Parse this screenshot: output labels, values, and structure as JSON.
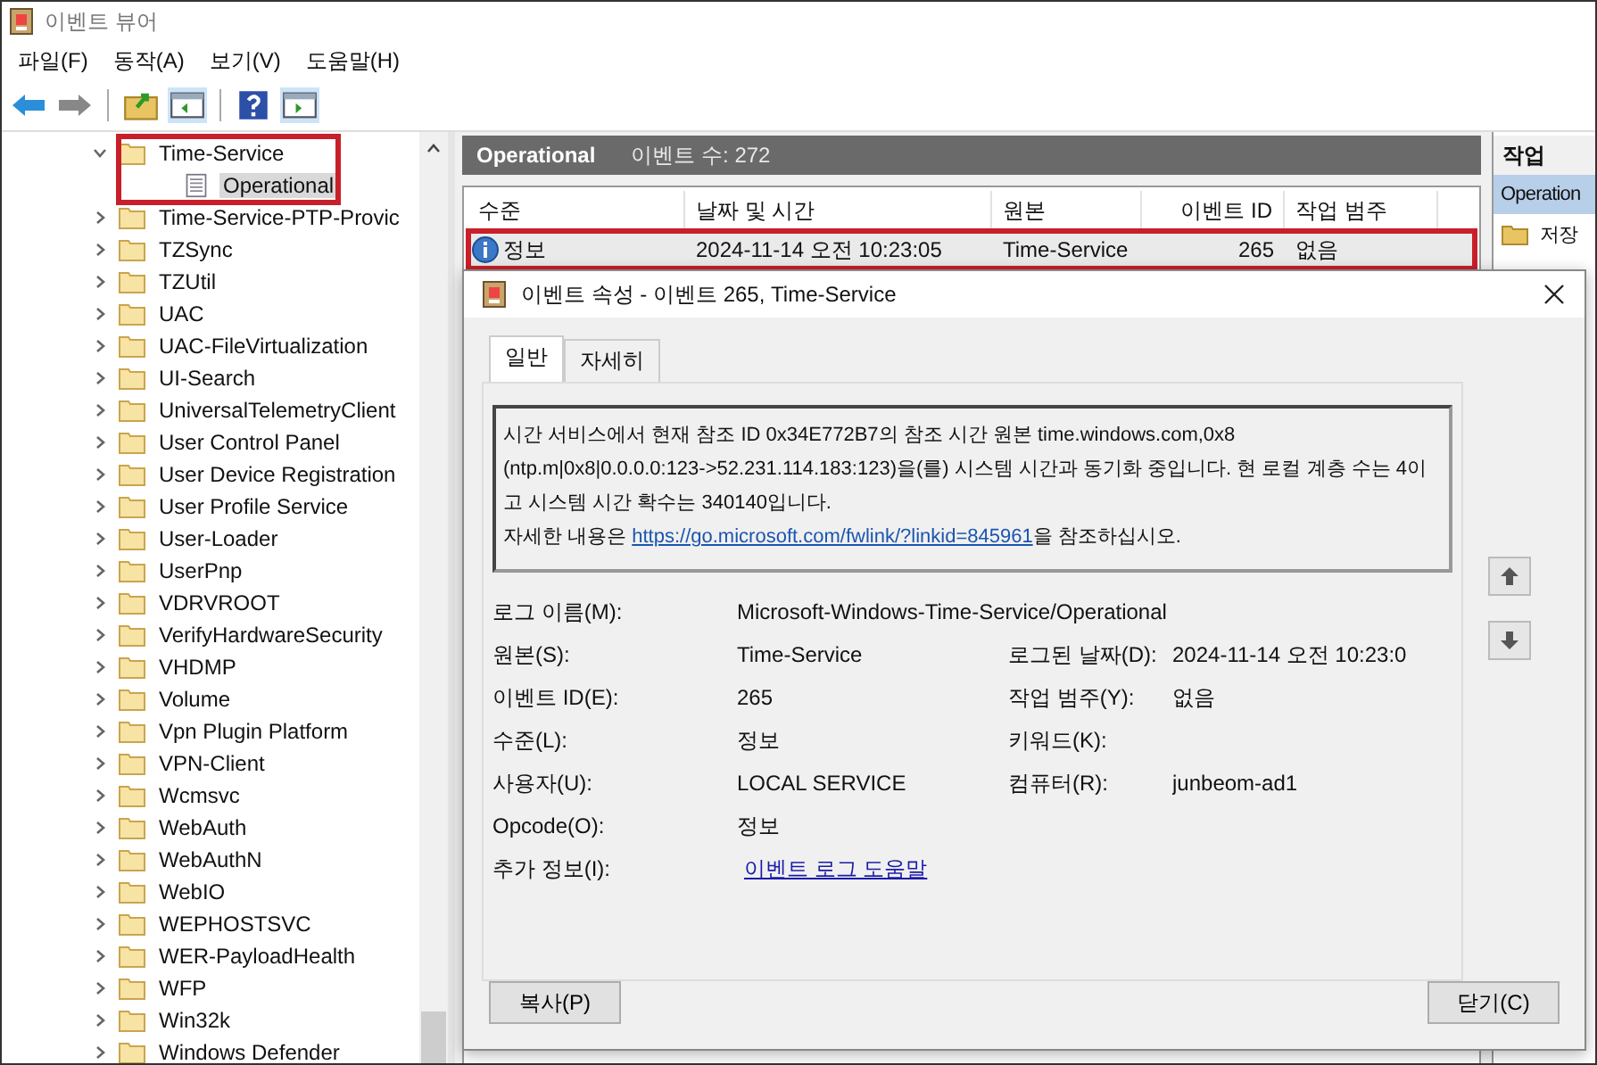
{
  "window": {
    "title": "이벤트 뷰어"
  },
  "menu": [
    {
      "label": "파일(F)"
    },
    {
      "label": "동작(A)"
    },
    {
      "label": "보기(V)"
    },
    {
      "label": "도움말(H)"
    }
  ],
  "tree": [
    {
      "label": "Time-Service",
      "expanded": true,
      "highlighted": true,
      "selected": false,
      "children": [
        {
          "label": "Operational",
          "kind": "log",
          "selected": true
        }
      ]
    },
    {
      "label": "Time-Service-PTP-Provic",
      "expanded": false,
      "highlighted": false,
      "selected": false
    },
    {
      "label": "TZSync",
      "expanded": false,
      "highlighted": false,
      "selected": false
    },
    {
      "label": "TZUtil",
      "expanded": false,
      "highlighted": false,
      "selected": false
    },
    {
      "label": "UAC",
      "expanded": false,
      "highlighted": false,
      "selected": false
    },
    {
      "label": "UAC-FileVirtualization",
      "expanded": false,
      "highlighted": false,
      "selected": false
    },
    {
      "label": "UI-Search",
      "expanded": false,
      "highlighted": false,
      "selected": false
    },
    {
      "label": "UniversalTelemetryClient",
      "expanded": false,
      "highlighted": false,
      "selected": false
    },
    {
      "label": "User Control Panel",
      "expanded": false,
      "highlighted": false,
      "selected": false
    },
    {
      "label": "User Device Registration",
      "expanded": false,
      "highlighted": false,
      "selected": false
    },
    {
      "label": "User Profile Service",
      "expanded": false,
      "highlighted": false,
      "selected": false
    },
    {
      "label": "User-Loader",
      "expanded": false,
      "highlighted": false,
      "selected": false
    },
    {
      "label": "UserPnp",
      "expanded": false,
      "highlighted": false,
      "selected": false
    },
    {
      "label": "VDRVROOT",
      "expanded": false,
      "highlighted": false,
      "selected": false
    },
    {
      "label": "VerifyHardwareSecurity",
      "expanded": false,
      "highlighted": false,
      "selected": false
    },
    {
      "label": "VHDMP",
      "expanded": false,
      "highlighted": false,
      "selected": false
    },
    {
      "label": "Volume",
      "expanded": false,
      "highlighted": false,
      "selected": false
    },
    {
      "label": "Vpn Plugin Platform",
      "expanded": false,
      "highlighted": false,
      "selected": false
    },
    {
      "label": "VPN-Client",
      "expanded": false,
      "highlighted": false,
      "selected": false
    },
    {
      "label": "Wcmsvc",
      "expanded": false,
      "highlighted": false,
      "selected": false
    },
    {
      "label": "WebAuth",
      "expanded": false,
      "highlighted": false,
      "selected": false
    },
    {
      "label": "WebAuthN",
      "expanded": false,
      "highlighted": false,
      "selected": false
    },
    {
      "label": "WebIO",
      "expanded": false,
      "highlighted": false,
      "selected": false
    },
    {
      "label": "WEPHOSTSVC",
      "expanded": false,
      "highlighted": false,
      "selected": false
    },
    {
      "label": "WER-PayloadHealth",
      "expanded": false,
      "highlighted": false,
      "selected": false
    },
    {
      "label": "WFP",
      "expanded": false,
      "highlighted": false,
      "selected": false
    },
    {
      "label": "Win32k",
      "expanded": false,
      "highlighted": false,
      "selected": false
    },
    {
      "label": "Windows Defender",
      "expanded": false,
      "highlighted": false,
      "selected": false
    }
  ],
  "log_header": {
    "title": "Operational",
    "count": "이벤트 수: 272"
  },
  "table": {
    "columns": [
      "수준",
      "날짜 및 시간",
      "원본",
      "이벤트 ID",
      "작업 범주"
    ],
    "rows": [
      {
        "level": "정보",
        "kind": "info",
        "date": "2024-11-14 오전 10:23:05",
        "source": "Time-Service",
        "id": "265",
        "category": "없음",
        "selected": true,
        "highlighted": true
      }
    ]
  },
  "actions": {
    "title": "작업",
    "items": [
      {
        "label": "Operation",
        "kind": "header",
        "selected": true
      },
      {
        "label": "저장",
        "kind": "folder",
        "selected": false
      }
    ]
  },
  "dialog": {
    "title": "이벤트 속성 - 이벤트 265, Time-Service",
    "tabs": [
      {
        "label": "일반",
        "selected": true
      },
      {
        "label": "자세히",
        "selected": false
      }
    ],
    "message": "시간 서비스에서 현재 참조 ID 0x34E772B7의 참조 시간 원본 time.windows.com,0x8 (ntp.m|0x8|0.0.0.0:123->52.231.114.183:123)을(를) 시스템 시간과 동기화 중입니다. 현 로컬 계층 수는 4이고 시스템 시간 확수는 340140입니다.",
    "more_prefix": "자세한 내용은 ",
    "more_link": "https://go.microsoft.com/fwlink/?linkid=845961",
    "more_suffix": "을 참조하십시오.",
    "log_name_label": "로그 이름(M):",
    "log_name": "Microsoft-Windows-Time-Service/Operational",
    "fields": [
      [
        {
          "label": "원본(S):",
          "value": "Time-Service"
        },
        {
          "label": "로그된 날짜(D):",
          "value": "2024-11-14 오전 10:23:0"
        }
      ],
      [
        {
          "label": "이벤트 ID(E):",
          "value": "265"
        },
        {
          "label": "작업 범주(Y):",
          "value": "없음"
        }
      ],
      [
        {
          "label": "수준(L):",
          "value": "정보"
        },
        {
          "label": "키워드(K):"
        }
      ],
      [
        {
          "label": "사용자(U):",
          "value": "LOCAL SERVICE"
        },
        {
          "label": "컴퓨터(R):",
          "value": "junbeom-ad1"
        }
      ],
      [
        {
          "label": "Opcode(O):",
          "value": "정보"
        }
      ]
    ],
    "more_info_label": "추가 정보(I):",
    "more_info_link": "이벤트 로그 도움말",
    "buttons": {
      "copy": "복사(P)",
      "close": "닫기(C)"
    }
  }
}
